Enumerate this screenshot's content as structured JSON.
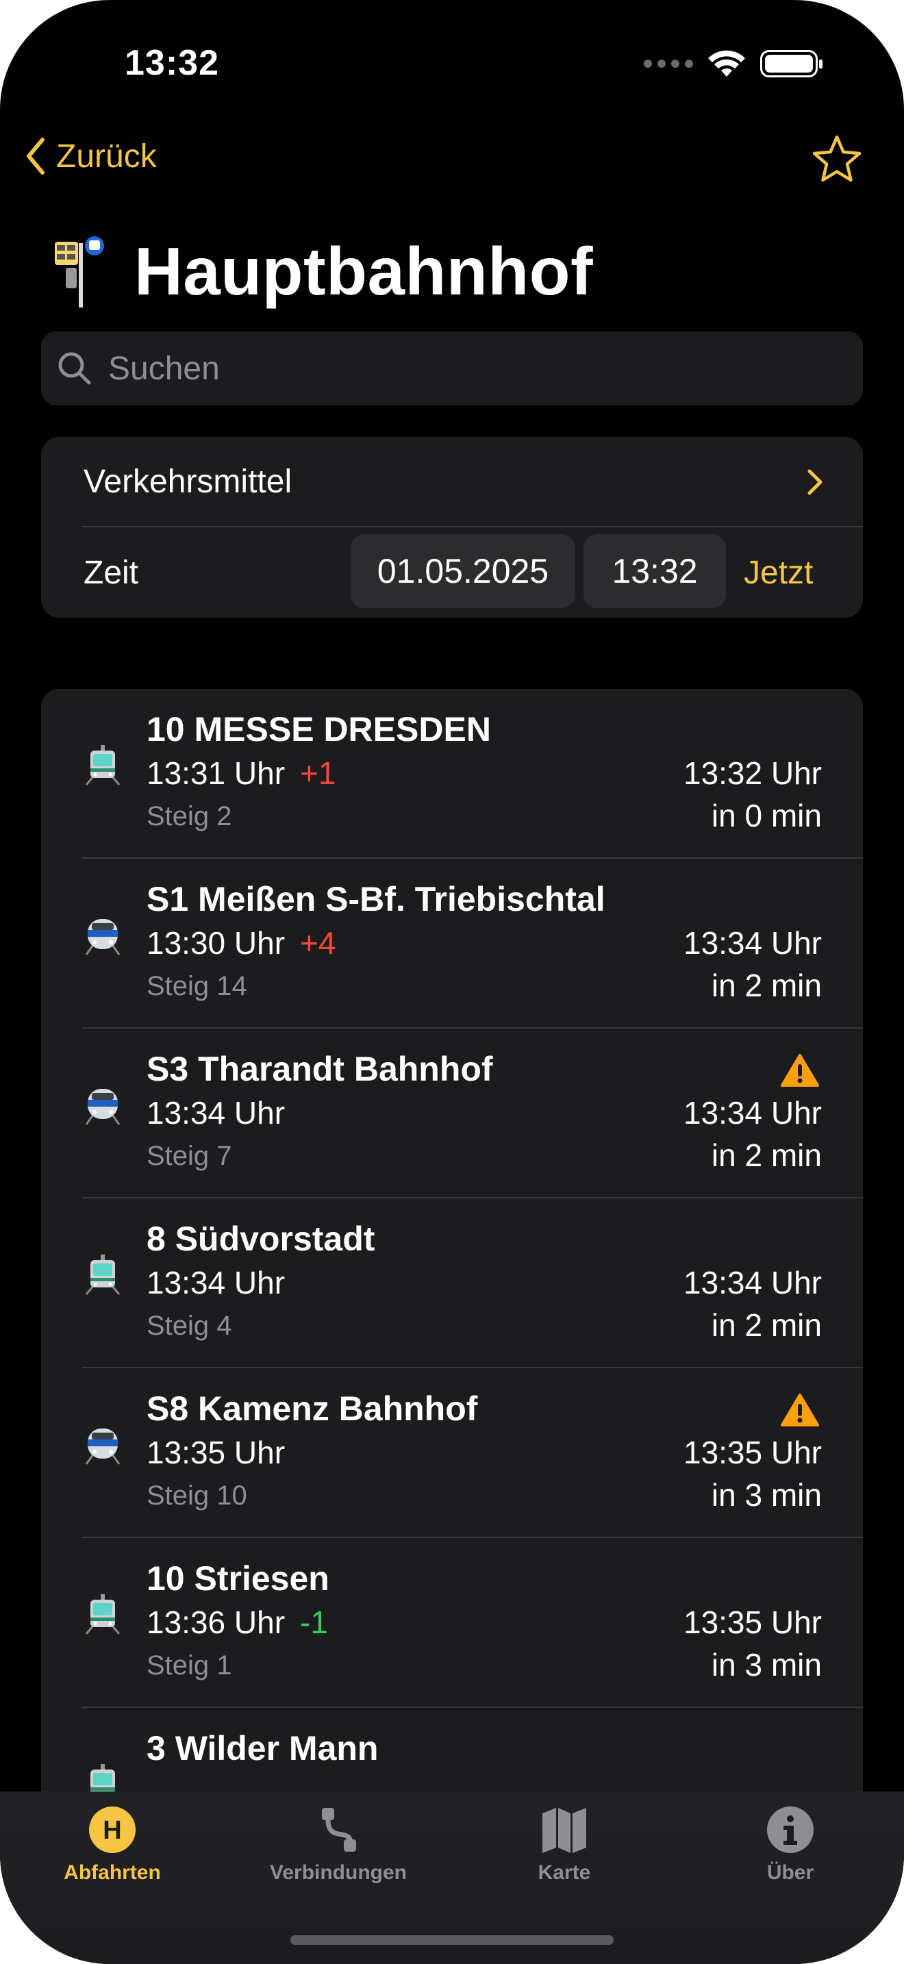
{
  "status_bar": {
    "time": "13:32"
  },
  "nav": {
    "back_label": "Zurück"
  },
  "header": {
    "title": "Hauptbahnhof"
  },
  "search": {
    "placeholder": "Suchen"
  },
  "filters": {
    "transport_label": "Verkehrsmittel",
    "time_label": "Zeit",
    "date_value": "01.05.2025",
    "time_value": "13:32",
    "now_label": "Jetzt"
  },
  "departures": [
    {
      "line": "10 MESSE DRESDEN",
      "planned": "13:31 Uhr",
      "delay": "+1",
      "delay_type": "late",
      "platform": "Steig 2",
      "actual": "13:32 Uhr",
      "relative": "in 0 min",
      "warning": false,
      "vehicle": "tram"
    },
    {
      "line": "S1 Meißen S-Bf. Triebischtal",
      "planned": "13:30 Uhr",
      "delay": "+4",
      "delay_type": "late",
      "platform": "Steig 14",
      "actual": "13:34 Uhr",
      "relative": "in 2 min",
      "warning": false,
      "vehicle": "train"
    },
    {
      "line": "S3 Tharandt Bahnhof",
      "planned": "13:34 Uhr",
      "delay": "",
      "delay_type": "",
      "platform": "Steig 7",
      "actual": "13:34 Uhr",
      "relative": "in 2 min",
      "warning": true,
      "vehicle": "train"
    },
    {
      "line": "8 Südvorstadt",
      "planned": "13:34 Uhr",
      "delay": "",
      "delay_type": "",
      "platform": "Steig 4",
      "actual": "13:34 Uhr",
      "relative": "in 2 min",
      "warning": false,
      "vehicle": "tram"
    },
    {
      "line": "S8 Kamenz Bahnhof",
      "planned": "13:35 Uhr",
      "delay": "",
      "delay_type": "",
      "platform": "Steig 10",
      "actual": "13:35 Uhr",
      "relative": "in 3 min",
      "warning": true,
      "vehicle": "train"
    },
    {
      "line": "10 Striesen",
      "planned": "13:36 Uhr",
      "delay": "-1",
      "delay_type": "early",
      "platform": "Steig 1",
      "actual": "13:35 Uhr",
      "relative": "in 3 min",
      "warning": false,
      "vehicle": "tram"
    },
    {
      "line": "3 Wilder Mann",
      "planned": "",
      "delay": "",
      "delay_type": "",
      "platform": "",
      "actual": "",
      "relative": "",
      "warning": false,
      "vehicle": "tram"
    }
  ],
  "tabs": [
    {
      "label": "Abfahrten",
      "icon": "h-station-icon",
      "active": true
    },
    {
      "label": "Verbindungen",
      "icon": "route-icon",
      "active": false
    },
    {
      "label": "Karte",
      "icon": "map-icon",
      "active": false
    },
    {
      "label": "Über",
      "icon": "info-icon",
      "active": false
    }
  ],
  "colors": {
    "accent": "#f5c543",
    "late": "#ff453a",
    "early": "#30d158",
    "warning": "#ff9f0a",
    "card": "#1c1c1e"
  }
}
